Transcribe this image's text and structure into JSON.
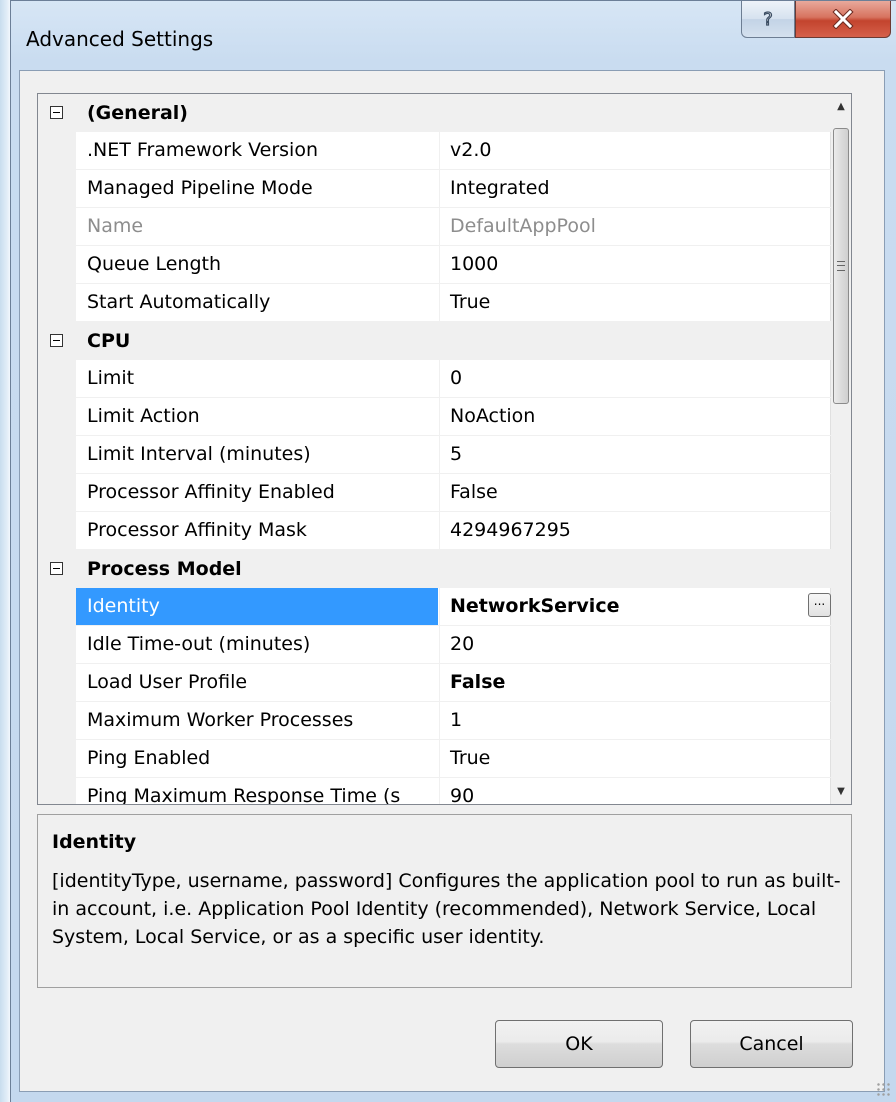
{
  "window": {
    "title": "Advanced Settings",
    "help_glyph": "?",
    "close_glyph": "X"
  },
  "grid": {
    "categories": [
      {
        "name": "(General)",
        "props": [
          {
            "name": ".NET Framework Version",
            "value": "v2.0"
          },
          {
            "name": "Managed Pipeline Mode",
            "value": "Integrated"
          },
          {
            "name": "Name",
            "value": "DefaultAppPool",
            "disabled": true
          },
          {
            "name": "Queue Length",
            "value": "1000"
          },
          {
            "name": "Start Automatically",
            "value": "True"
          }
        ]
      },
      {
        "name": "CPU",
        "props": [
          {
            "name": "Limit",
            "value": "0"
          },
          {
            "name": "Limit Action",
            "value": "NoAction"
          },
          {
            "name": "Limit Interval (minutes)",
            "value": "5"
          },
          {
            "name": "Processor Affinity Enabled",
            "value": "False"
          },
          {
            "name": "Processor Affinity Mask",
            "value": "4294967295"
          }
        ]
      },
      {
        "name": "Process Model",
        "props": [
          {
            "name": "Identity",
            "value": "NetworkService",
            "selected": true,
            "has_ellipsis": true
          },
          {
            "name": "Idle Time-out (minutes)",
            "value": "20"
          },
          {
            "name": "Load User Profile",
            "value": "False",
            "bold": true
          },
          {
            "name": "Maximum Worker Processes",
            "value": "1"
          },
          {
            "name": "Ping Enabled",
            "value": "True"
          },
          {
            "name": "Ping Maximum Response Time (s",
            "value": "90"
          }
        ]
      }
    ],
    "ellipsis_label": "...",
    "scroll_up_glyph": "▲",
    "scroll_down_glyph": "▼"
  },
  "description": {
    "title": "Identity",
    "text": "[identityType, username, password] Configures the application pool to run as built-in account, i.e. Application Pool Identity (recommended), Network Service, Local System, Local Service, or as a specific user identity."
  },
  "buttons": {
    "ok": "OK",
    "cancel": "Cancel"
  }
}
